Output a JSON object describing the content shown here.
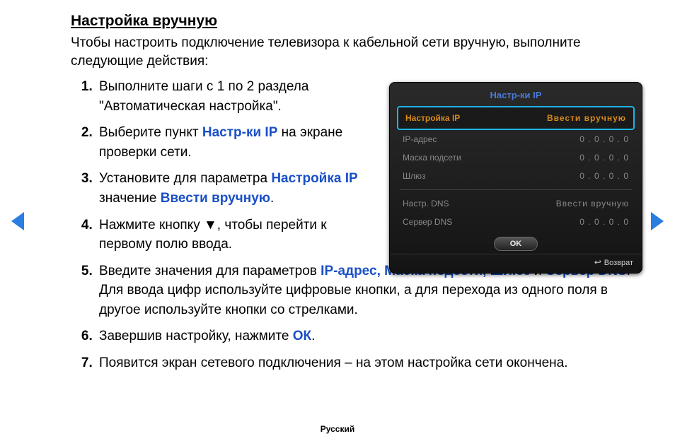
{
  "page": {
    "title": "Настройка вручную",
    "intro": "Чтобы настроить подключение телевизора к кабельной сети вручную, выполните следующие действия:",
    "lang": "Русский"
  },
  "steps": {
    "s1": "Выполните шаги с 1 по 2 раздела \"Автоматическая настройка\".",
    "s2a": "Выберите пункт ",
    "s2b": "Настр-ки IP",
    "s2c": " на экране проверки сети.",
    "s3a": "Установите для параметра ",
    "s3b": "Настройка IP",
    "s3c": " значение ",
    "s3d": "Ввести вручную",
    "s3e": ".",
    "s4": "Нажмите кнопку ▼, чтобы перейти к первому полю ввода.",
    "s5a": "Введите значения для параметров ",
    "s5b": "IP-адрес, Маска подсети, Шлюз",
    "s5c": " и ",
    "s5d": "Сервер DNS",
    "s5e": ". Для ввода цифр используйте цифровые кнопки, а для перехода из одного поля в другое используйте кнопки со стрелками.",
    "s6a": "Завершив настройку, нажмите ",
    "s6b": "ОК",
    "s6c": ".",
    "s7": "Появится экран сетевого подключения – на этом настройка сети окончена."
  },
  "dialog": {
    "title": "Настр-ки IP",
    "row_setup_label": "Настройка IP",
    "row_setup_value": "Ввести вручную",
    "row_ip_label": "IP-адрес",
    "row_ip_value": "0 . 0 . 0 . 0",
    "row_mask_label": "Маска подсети",
    "row_mask_value": "0 . 0 . 0 . 0",
    "row_gw_label": "Шлюз",
    "row_gw_value": "0 . 0 . 0 . 0",
    "row_dnscfg_label": "Настр. DNS",
    "row_dnscfg_value": "Ввести вручную",
    "row_dns_label": "Сервер DNS",
    "row_dns_value": "0 . 0 . 0 . 0",
    "ok": "OK",
    "return": "Возврат"
  }
}
